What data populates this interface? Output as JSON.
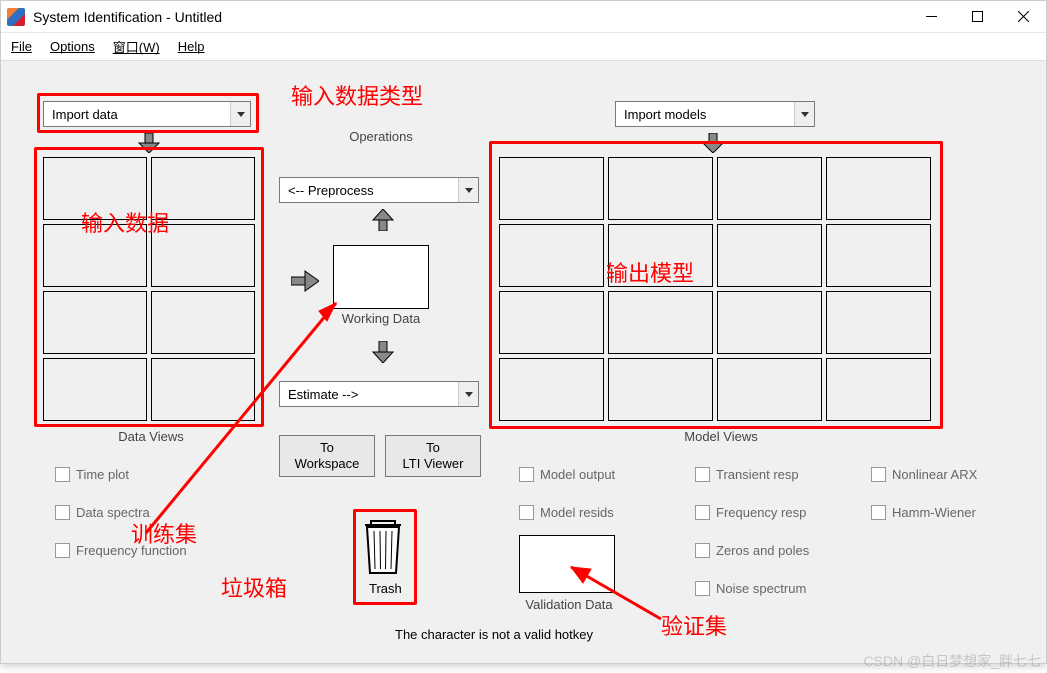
{
  "window": {
    "title": "System Identification - Untitled"
  },
  "menu": {
    "file": "File",
    "options": "Options",
    "window": "窗口(W)",
    "help": "Help"
  },
  "dropdowns": {
    "import_data": "Import data",
    "import_models": "Import models",
    "preprocess": "<-- Preprocess",
    "estimate": "Estimate -->"
  },
  "labels": {
    "operations": "Operations",
    "working_data": "Working Data",
    "data_views": "Data Views",
    "model_views": "Model Views",
    "validation_data": "Validation Data",
    "trash": "Trash"
  },
  "buttons": {
    "to_workspace": "To\nWorkspace",
    "to_lti": "To\nLTI Viewer"
  },
  "checks": {
    "time_plot": "Time plot",
    "data_spectra": "Data spectra",
    "freq_func": "Frequency function",
    "model_output": "Model output",
    "model_resids": "Model resids",
    "transient_resp": "Transient resp",
    "freq_resp": "Frequency resp",
    "zeros_poles": "Zeros and poles",
    "noise_spectrum": "Noise spectrum",
    "nonlinear_arx": "Nonlinear ARX",
    "hamm_wiener": "Hamm-Wiener"
  },
  "status": {
    "hotkey_msg": "The character   is not a valid hotkey"
  },
  "annotations": {
    "input_type": "输入数据类型",
    "input_data": "输入数据",
    "output_model": "输出模型",
    "train_set": "训练集",
    "trash": "垃圾箱",
    "valid_set": "验证集"
  },
  "watermark": "CSDN @白日梦想家_胖七七"
}
